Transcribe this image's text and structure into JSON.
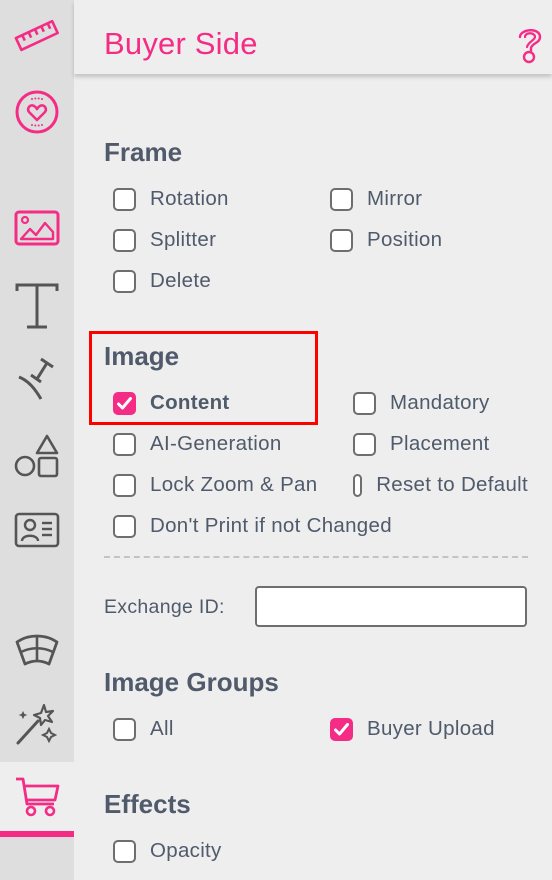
{
  "sidebar": {
    "items": [
      {
        "icon": "ruler-icon",
        "selected": false,
        "color": "#f52c86"
      },
      {
        "icon": "heart-badge-icon",
        "selected": false,
        "color": "#f52c86"
      },
      {
        "icon": "image-icon",
        "selected": false,
        "color": "#f52c86"
      },
      {
        "icon": "text-icon",
        "selected": false,
        "color": "#555555"
      },
      {
        "icon": "curved-text-icon",
        "selected": false,
        "color": "#555555"
      },
      {
        "icon": "shapes-icon",
        "selected": false,
        "color": "#555555"
      },
      {
        "icon": "contact-card-icon",
        "selected": false,
        "color": "#555555"
      },
      {
        "icon": "warp-grid-icon",
        "selected": false,
        "color": "#555555"
      },
      {
        "icon": "magic-wand-icon",
        "selected": false,
        "color": "#555555"
      },
      {
        "icon": "cart-icon",
        "selected": true,
        "color": "#f52c86"
      }
    ]
  },
  "header": {
    "title": "Buyer Side",
    "help_icon": "question-mark-icon"
  },
  "colors": {
    "accent": "#f52c86",
    "text": "#4f5a6b",
    "annotation": "#ff0000"
  },
  "sections": {
    "frame": {
      "title": "Frame",
      "options": [
        {
          "label": "Rotation",
          "checked": false
        },
        {
          "label": "Mirror",
          "checked": false
        },
        {
          "label": "Splitter",
          "checked": false
        },
        {
          "label": "Position",
          "checked": false
        },
        {
          "label": "Delete",
          "checked": false
        }
      ]
    },
    "image": {
      "title": "Image",
      "options": [
        {
          "label": "Content",
          "checked": true
        },
        {
          "label": "Mandatory",
          "checked": false
        },
        {
          "label": "AI-Generation",
          "checked": false
        },
        {
          "label": "Placement",
          "checked": false
        },
        {
          "label": "Lock Zoom & Pan",
          "checked": false
        },
        {
          "label": "Reset to Default",
          "checked": false
        },
        {
          "label": "Don't Print if not Changed",
          "checked": false
        }
      ],
      "exchange_id_label": "Exchange ID:",
      "exchange_id_value": "",
      "exchange_id_placeholder": ""
    },
    "image_groups": {
      "title": "Image Groups",
      "options": [
        {
          "label": "All",
          "checked": false
        },
        {
          "label": "Buyer Upload",
          "checked": true
        }
      ]
    },
    "effects": {
      "title": "Effects",
      "options": [
        {
          "label": "Opacity",
          "checked": false
        }
      ]
    }
  }
}
